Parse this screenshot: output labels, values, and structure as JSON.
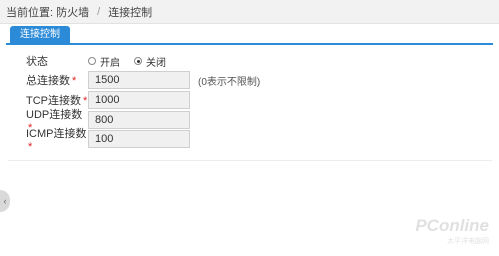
{
  "breadcrumb": {
    "current_location": "当前位置: 防火墙",
    "separator": "/",
    "page": "连接控制"
  },
  "tabs": [
    {
      "label": "连接控制",
      "active": true
    }
  ],
  "form": {
    "status": {
      "label": "状态",
      "options": [
        {
          "label": "开启",
          "checked": false
        },
        {
          "label": "关闭",
          "checked": true
        }
      ]
    },
    "total_connections": {
      "label": "总连接数",
      "required_mark": "*",
      "value": "1500",
      "hint": "(0表示不限制)"
    },
    "tcp_connections": {
      "label": "TCP连接数",
      "required_mark": "*",
      "value": "1000"
    },
    "udp_connections": {
      "label": "UDP连接数",
      "required_mark": "*",
      "value": "800"
    },
    "icmp_connections": {
      "label": "ICMP连接数",
      "required_mark": "*",
      "value": "100"
    }
  },
  "side_handle": {
    "glyph": "‹"
  },
  "watermark": {
    "brand": "PConline",
    "sub": "太平洋电脑网"
  },
  "colors": {
    "accent": "#2c8bd8",
    "required": "#e02020"
  }
}
